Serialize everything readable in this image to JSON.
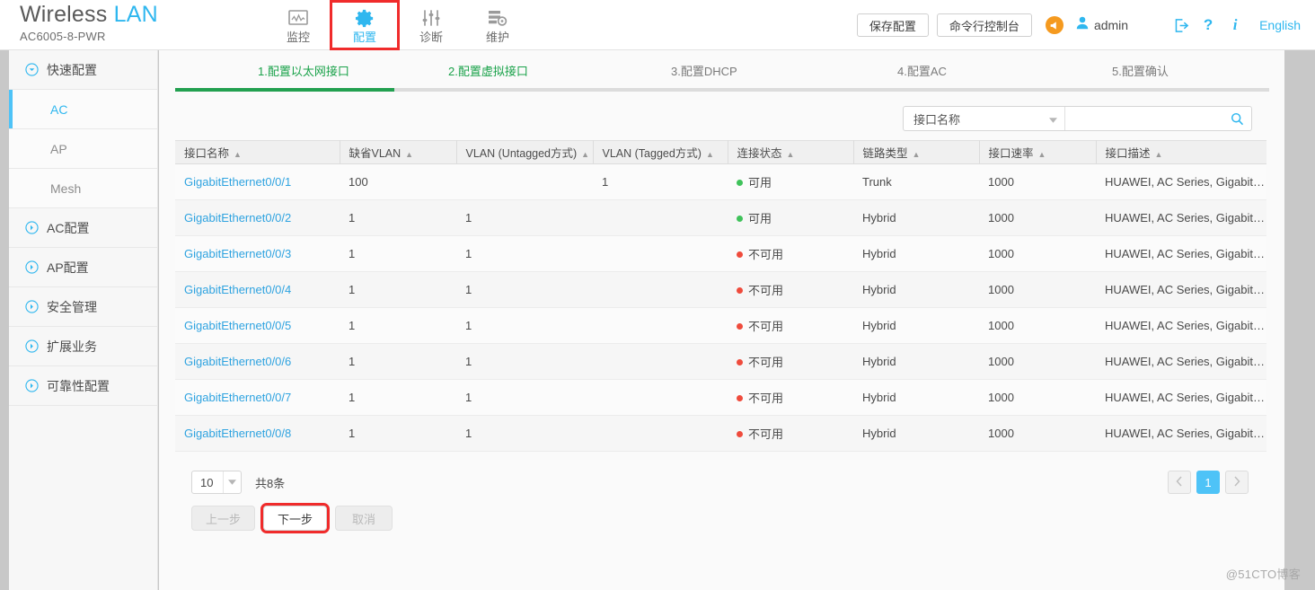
{
  "header": {
    "brand_title_main": "Wireless",
    "brand_title_accent": "LAN",
    "device_model": "AC6005-8-PWR",
    "nav": [
      {
        "label": "监控",
        "icon": "monitor-icon",
        "active": false,
        "highlighted": false
      },
      {
        "label": "配置",
        "icon": "gear-icon",
        "active": true,
        "highlighted": true
      },
      {
        "label": "诊断",
        "icon": "sliders-icon",
        "active": false,
        "highlighted": false
      },
      {
        "label": "维护",
        "icon": "maintenance-icon",
        "active": false,
        "highlighted": false
      }
    ],
    "save_config_label": "保存配置",
    "cli_console_label": "命令行控制台",
    "alarm_icon": "alarm-bell-icon",
    "user_icon": "user-icon",
    "user_name": "admin",
    "logout_icon": "logout-icon",
    "help_icon": "help-question-icon",
    "info_icon": "info-icon",
    "language_label": "English"
  },
  "sidebar": {
    "items": [
      {
        "label": "快速配置",
        "icon": "chevron-down-circle-icon",
        "type": "group",
        "expanded": true
      },
      {
        "label": "AC",
        "type": "sub",
        "active": true
      },
      {
        "label": "AP",
        "type": "sub",
        "active": false
      },
      {
        "label": "Mesh",
        "type": "sub",
        "active": false
      },
      {
        "label": "AC配置",
        "icon": "chevron-right-circle-icon",
        "type": "group",
        "expanded": false
      },
      {
        "label": "AP配置",
        "icon": "chevron-right-circle-icon",
        "type": "group",
        "expanded": false
      },
      {
        "label": "安全管理",
        "icon": "chevron-right-circle-icon",
        "type": "group",
        "expanded": false
      },
      {
        "label": "扩展业务",
        "icon": "chevron-right-circle-icon",
        "type": "group",
        "expanded": false
      },
      {
        "label": "可靠性配置",
        "icon": "chevron-right-circle-icon",
        "type": "group",
        "expanded": false
      }
    ]
  },
  "wizard": {
    "steps": [
      {
        "label": "1.配置以太网接口",
        "state": "done"
      },
      {
        "label": "2.配置虚拟接口",
        "state": "done"
      },
      {
        "label": "3.配置DHCP",
        "state": "todo"
      },
      {
        "label": "4.配置AC",
        "state": "todo"
      },
      {
        "label": "5.配置确认",
        "state": "todo"
      }
    ],
    "progress_percent": 20,
    "prev_label": "上一步",
    "next_label": "下一步",
    "cancel_label": "取消",
    "next_highlighted": true,
    "prev_disabled": true,
    "cancel_disabled": true
  },
  "search": {
    "field_label": "接口名称",
    "dropdown_icon": "chevron-down-icon",
    "input_value": "",
    "placeholder": "",
    "search_icon": "search-icon"
  },
  "table": {
    "columns": [
      "接口名称",
      "缺省VLAN",
      "VLAN (Untagged方式)",
      "VLAN (Tagged方式)",
      "连接状态",
      "链路类型",
      "接口速率",
      "接口描述"
    ],
    "sort_icon": "sort-asc-caret-icon",
    "rows": [
      {
        "name": "GigabitEthernet0/0/1",
        "default_vlan": "100",
        "vlan_untagged": "",
        "vlan_tagged": "1",
        "status": "可用",
        "status_state": "up",
        "link_type": "Trunk",
        "speed": "1000",
        "description": "HUAWEI, AC Series, GigabitEth..."
      },
      {
        "name": "GigabitEthernet0/0/2",
        "default_vlan": "1",
        "vlan_untagged": "1",
        "vlan_tagged": "",
        "status": "可用",
        "status_state": "up",
        "link_type": "Hybrid",
        "speed": "1000",
        "description": "HUAWEI, AC Series, GigabitEth..."
      },
      {
        "name": "GigabitEthernet0/0/3",
        "default_vlan": "1",
        "vlan_untagged": "1",
        "vlan_tagged": "",
        "status": "不可用",
        "status_state": "down",
        "link_type": "Hybrid",
        "speed": "1000",
        "description": "HUAWEI, AC Series, GigabitEth..."
      },
      {
        "name": "GigabitEthernet0/0/4",
        "default_vlan": "1",
        "vlan_untagged": "1",
        "vlan_tagged": "",
        "status": "不可用",
        "status_state": "down",
        "link_type": "Hybrid",
        "speed": "1000",
        "description": "HUAWEI, AC Series, GigabitEth..."
      },
      {
        "name": "GigabitEthernet0/0/5",
        "default_vlan": "1",
        "vlan_untagged": "1",
        "vlan_tagged": "",
        "status": "不可用",
        "status_state": "down",
        "link_type": "Hybrid",
        "speed": "1000",
        "description": "HUAWEI, AC Series, GigabitEth..."
      },
      {
        "name": "GigabitEthernet0/0/6",
        "default_vlan": "1",
        "vlan_untagged": "1",
        "vlan_tagged": "",
        "status": "不可用",
        "status_state": "down",
        "link_type": "Hybrid",
        "speed": "1000",
        "description": "HUAWEI, AC Series, GigabitEth..."
      },
      {
        "name": "GigabitEthernet0/0/7",
        "default_vlan": "1",
        "vlan_untagged": "1",
        "vlan_tagged": "",
        "status": "不可用",
        "status_state": "down",
        "link_type": "Hybrid",
        "speed": "1000",
        "description": "HUAWEI, AC Series, GigabitEth..."
      },
      {
        "name": "GigabitEthernet0/0/8",
        "default_vlan": "1",
        "vlan_untagged": "1",
        "vlan_tagged": "",
        "status": "不可用",
        "status_state": "down",
        "link_type": "Hybrid",
        "speed": "1000",
        "description": "HUAWEI, AC Series, GigabitEth..."
      }
    ]
  },
  "footer": {
    "page_size": "10",
    "page_size_caret": "chevron-down-icon",
    "total_label": "共8条",
    "prev_page_icon": "chevron-left-icon",
    "next_page_icon": "chevron-right-icon",
    "current_page": "1"
  },
  "watermark": "@51CTO博客",
  "colors": {
    "accent_blue": "#2fb7ef",
    "link_blue": "#2fa3e0",
    "progress_green": "#22a050",
    "status_up": "#3fc25a",
    "status_down": "#ef4b3c",
    "highlight_red": "#f02b2b",
    "page_bg": "#c8c8c8"
  }
}
